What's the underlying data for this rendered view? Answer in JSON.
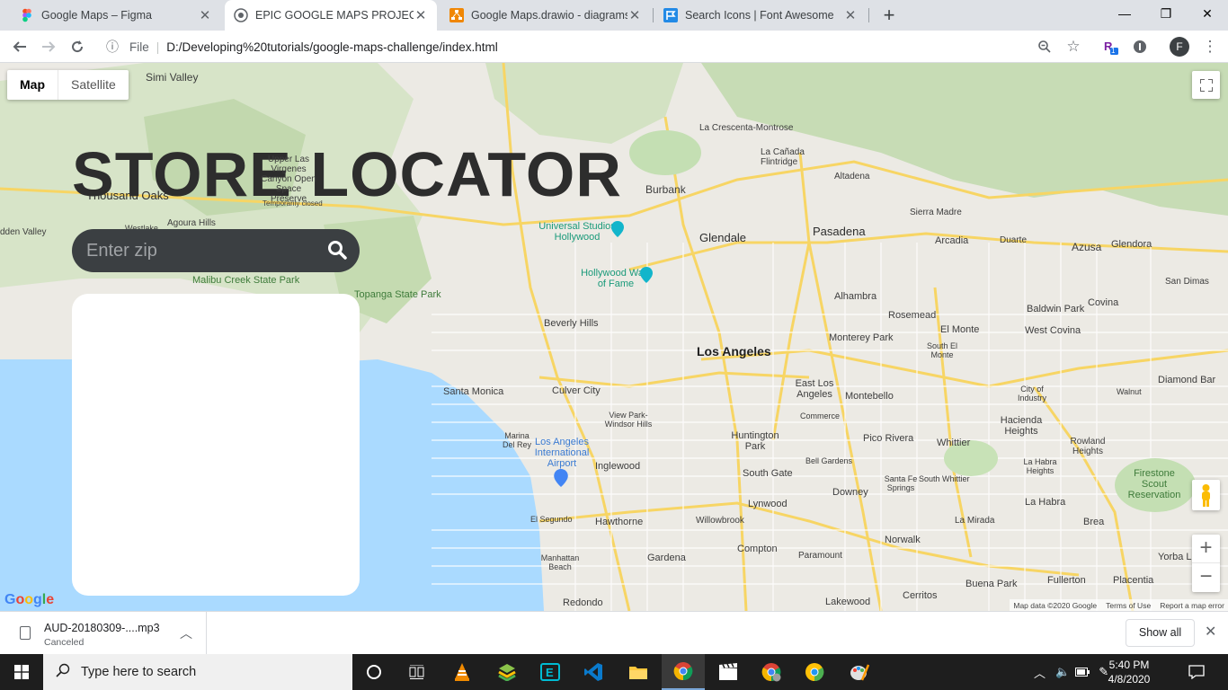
{
  "tabs": [
    {
      "title": "Google Maps – Figma",
      "favicon": "figma-icon",
      "active": false
    },
    {
      "title": "EPIC GOOGLE MAPS PROJECT",
      "favicon": "globe-icon",
      "active": true
    },
    {
      "title": "Google Maps.drawio - diagrams.",
      "favicon": "drawio-icon",
      "active": false
    },
    {
      "title": "Search Icons | Font Awesome",
      "favicon": "font-awesome-icon",
      "active": false
    }
  ],
  "address_bar": {
    "scheme_label": "File",
    "url": "D:/Developing%20tutorials/google-maps-challenge/index.html"
  },
  "profile_initial": "F",
  "extension_badge": "1",
  "map": {
    "type_control": {
      "map": "Map",
      "satellite": "Satellite"
    },
    "attribution": {
      "data": "Map data ©2020 Google",
      "terms": "Terms of Use",
      "report": "Report a map error"
    },
    "logo": "Google",
    "labels": [
      "Simi Valley",
      "Thousand Oaks",
      "Agoura Hills",
      "Malibu Creek State Park",
      "Topanga State Park",
      "Upper Las Virgenes Canyon Open Space Preserve",
      "Temporarily closed",
      "Westlake",
      "dden Valley",
      "Burbank",
      "Glendale",
      "Pasadena",
      "Altadena",
      "La Cañada Flintridge",
      "La Crescenta-Montrose",
      "Sierra Madre",
      "Arcadia",
      "Duarte",
      "Azusa",
      "Glendora",
      "San Dimas",
      "Covina",
      "Baldwin Park",
      "West Covina",
      "El Monte",
      "Rosemead",
      "Monterey Park",
      "Alhambra",
      "South El Monte",
      "Los Angeles",
      "Beverly Hills",
      "Santa Monica",
      "Culver City",
      "Universal Studios Hollywood",
      "Hollywood Walk of Fame",
      "Los Angeles International Airport",
      "Inglewood",
      "Huntington Park",
      "South Gate",
      "East Los Angeles",
      "Montebello",
      "Commerce",
      "Pico Rivera",
      "Whittier",
      "Hacienda Heights",
      "Rowland Heights",
      "Diamond Bar",
      "Walnut",
      "City of Industry",
      "Bell Gardens",
      "Downey",
      "Santa Fe Springs",
      "South Whittier",
      "La Habra Heights",
      "La Habra",
      "Firestone Scout Reservation",
      "Brea",
      "La Mirada",
      "Norwalk",
      "Lynwood",
      "Willowbrook",
      "Compton",
      "Paramount",
      "Hawthorne",
      "El Segundo",
      "Manhattan Beach",
      "Gardena",
      "Redondo",
      "Lakewood",
      "Cerritos",
      "Buena Park",
      "Fullerton",
      "Placentia",
      "Yorba L",
      "View Park-Windsor Hills",
      "Marina Del Rey"
    ]
  },
  "store_locator": {
    "title": "STORE LOCATOR",
    "zip_placeholder": "Enter zip"
  },
  "download_bar": {
    "file_name": "AUD-20180309-....mp3",
    "status": "Canceled",
    "show_all": "Show all"
  },
  "taskbar": {
    "search_placeholder": "Type here to search",
    "time": "5:40 PM",
    "date": "4/8/2020"
  }
}
